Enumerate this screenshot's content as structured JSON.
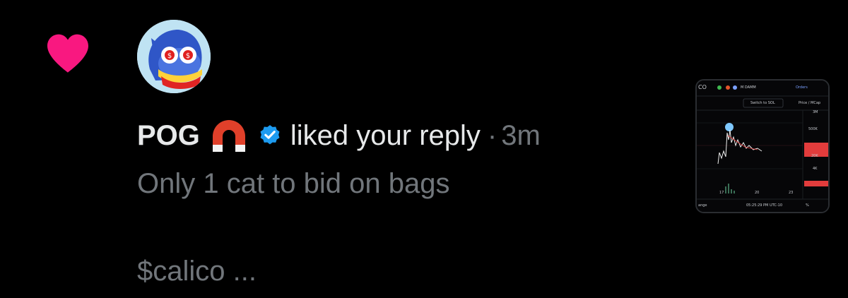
{
  "icons": {
    "heart": "heart-icon",
    "magnet": "magnet-icon",
    "verified": "verified-badge-icon"
  },
  "colors": {
    "background": "#000000",
    "heart": "#f91880",
    "verified": "#1d9bf0",
    "primary_text": "#e7e9ea",
    "secondary_text": "#71767b"
  },
  "notification": {
    "user_name": "POG",
    "action": "liked your reply",
    "separator": "·",
    "time": "3m",
    "reply_text": "Only 1 cat to bid on bags",
    "reply_text_2": "$calico ..."
  },
  "thumbnail": {
    "top_left": "CO",
    "source": "M DAMM",
    "orders": "Orders",
    "switch_label": "Switch to SOL",
    "price_label": "Price / MCap",
    "y_ticks": [
      "3M",
      "500K",
      "20K",
      "4K"
    ],
    "x_ticks": [
      "17",
      "20",
      "23"
    ],
    "range_label": "ange",
    "timestamp": "05:25:29 PM UTC-10",
    "percent": "%"
  }
}
